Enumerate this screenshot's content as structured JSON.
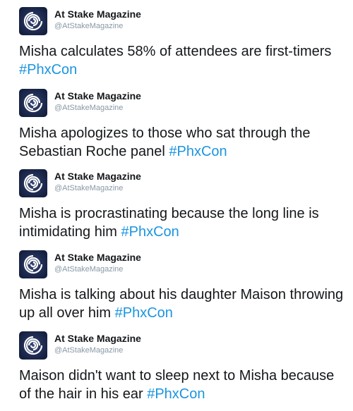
{
  "account": {
    "name": "At Stake Magazine",
    "handle": "@AtStakeMagazine",
    "avatar_icon": "swirl-logo-icon"
  },
  "colors": {
    "hashtag": "#1b95e0",
    "text": "#14171a",
    "handle": "#8899a6"
  },
  "tweets": [
    {
      "text": "Misha calculates 58% of attendees are first-timers ",
      "hashtag": "#PhxCon"
    },
    {
      "text": "Misha apologizes to those who sat through the Sebastian Roche panel ",
      "hashtag": "#PhxCon"
    },
    {
      "text": "Misha is procrastinating because the long line is intimidating him ",
      "hashtag": "#PhxCon"
    },
    {
      "text": "Misha is talking about his daughter Maison throwing up all over him ",
      "hashtag": "#PhxCon"
    },
    {
      "text": "Maison didn't want to sleep next to Misha because of the hair in his ear ",
      "hashtag": "#PhxCon"
    }
  ]
}
